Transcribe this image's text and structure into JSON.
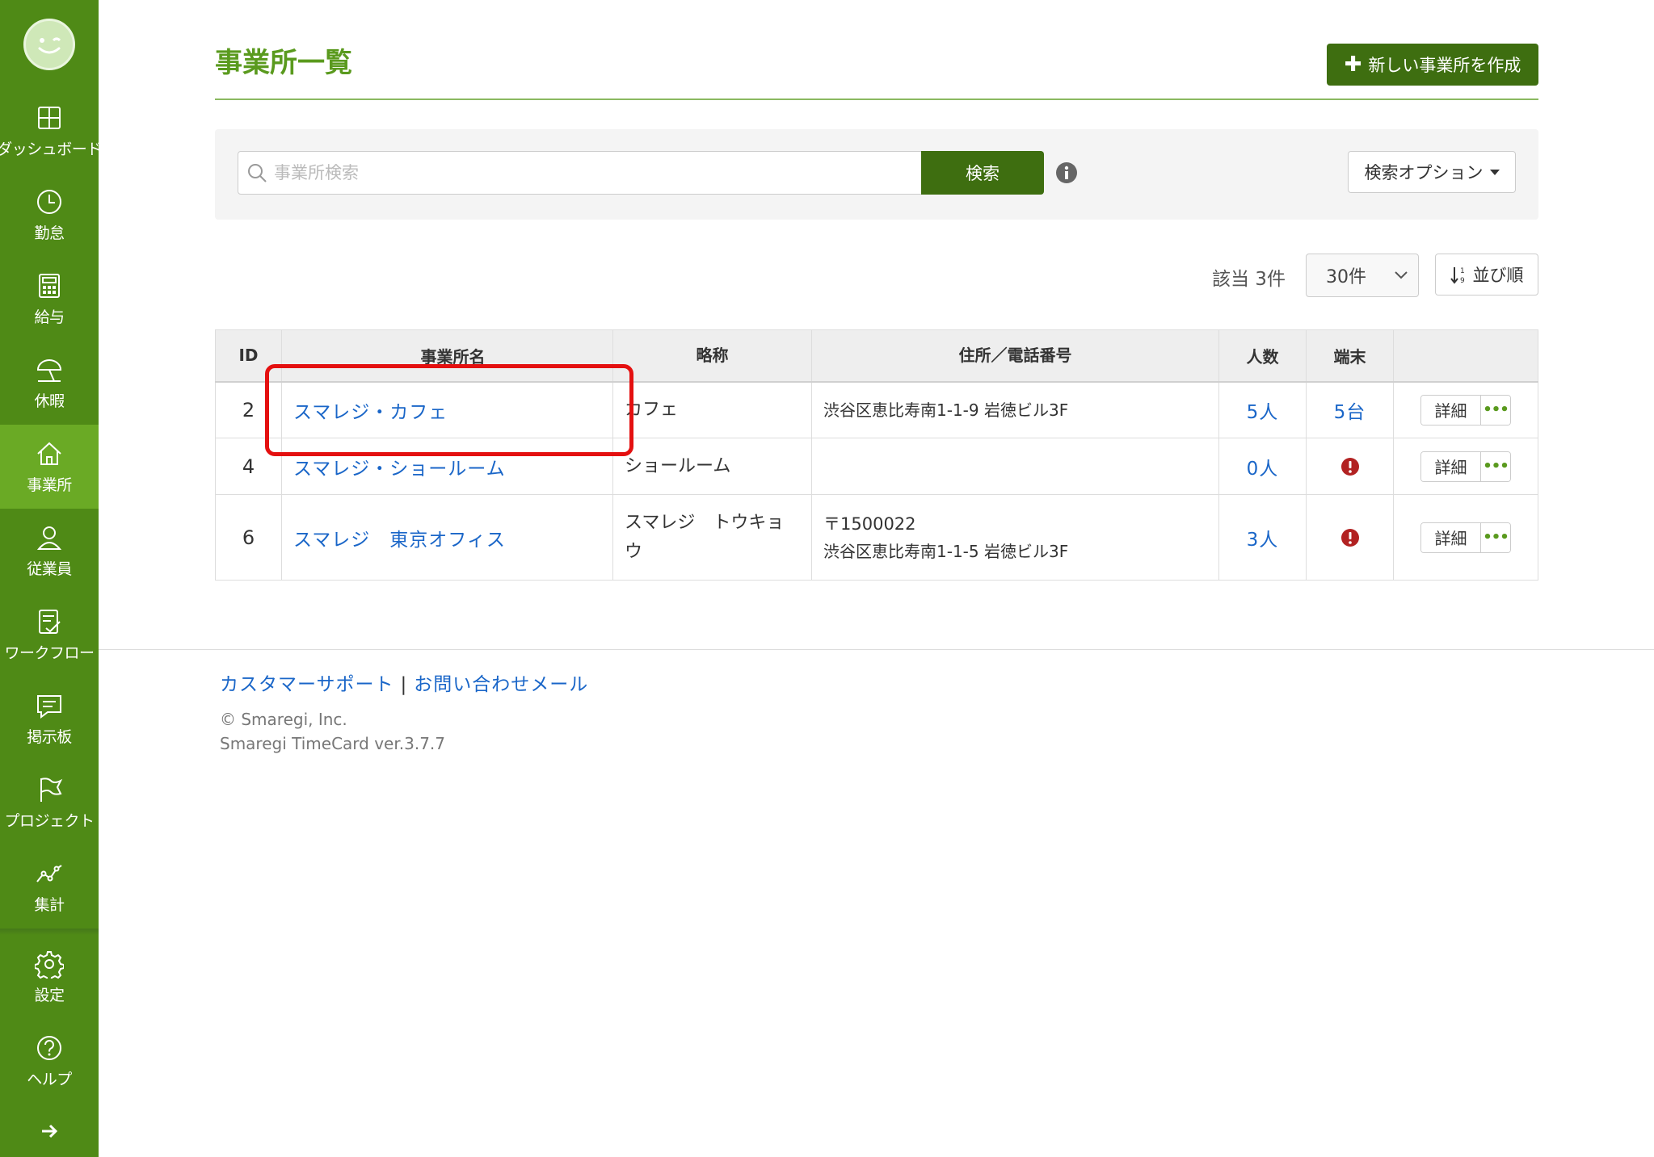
{
  "sidebar": {
    "items": [
      {
        "label": "ダッシュボード",
        "icon": "dashboard-icon"
      },
      {
        "label": "勤怠",
        "icon": "clock-icon"
      },
      {
        "label": "給与",
        "icon": "calculator-icon"
      },
      {
        "label": "休暇",
        "icon": "umbrella-icon"
      },
      {
        "label": "事業所",
        "icon": "home-icon",
        "active": true
      },
      {
        "label": "従業員",
        "icon": "user-icon"
      },
      {
        "label": "ワークフロー",
        "icon": "checklist-icon"
      },
      {
        "label": "掲示板",
        "icon": "message-icon"
      },
      {
        "label": "プロジェクト",
        "icon": "flag-icon"
      },
      {
        "label": "集計",
        "icon": "chart-line-icon"
      },
      {
        "label": "設定",
        "icon": "gear-icon"
      },
      {
        "label": "ヘルプ",
        "icon": "help-icon"
      }
    ]
  },
  "header": {
    "title": "事業所一覧",
    "create_label": "新しい事業所を作成"
  },
  "search": {
    "placeholder": "事業所検索",
    "button_label": "検索",
    "options_label": "検索オプション"
  },
  "results": {
    "count_label": "該当 3件",
    "per_page": "30件",
    "sort_label": "並び順"
  },
  "table": {
    "headers": {
      "id": "ID",
      "name": "事業所名",
      "abbr": "略称",
      "address": "住所／電話番号",
      "people": "人数",
      "terminal": "端末"
    },
    "rows": [
      {
        "id": "2",
        "name": "スマレジ・カフェ",
        "abbr": "カフェ",
        "address1": "渋谷区恵比寿南1-1-9 岩徳ビル3F",
        "address2": "",
        "people": "5人",
        "terminal": "5台",
        "detail": "詳細"
      },
      {
        "id": "4",
        "name": "スマレジ・ショールーム",
        "abbr": "ショールーム",
        "address1": "",
        "address2": "",
        "people": "0人",
        "terminal": "",
        "detail": "詳細"
      },
      {
        "id": "6",
        "name": "スマレジ　東京オフィス",
        "abbr": "スマレジ　トウキョウ",
        "address1": "〒1500022",
        "address2": "渋谷区恵比寿南1-1-5 岩徳ビル3F",
        "people": "3人",
        "terminal": "",
        "detail": "詳細"
      }
    ]
  },
  "footer": {
    "support_link": "カスタマーサポート",
    "separator": "|",
    "contact_link": "お問い合わせメール",
    "copyright": "© Smaregi, Inc.",
    "version": "Smaregi TimeCard ver.3.7.7"
  },
  "colors": {
    "sidebar_bg": "#4f8a16",
    "sidebar_active": "#6aaa25",
    "primary_button": "#3e6e10",
    "title_green": "#5a9a1e",
    "link_blue": "#1a66c8",
    "alert_red": "#b22222",
    "highlight_red": "#e41010"
  }
}
